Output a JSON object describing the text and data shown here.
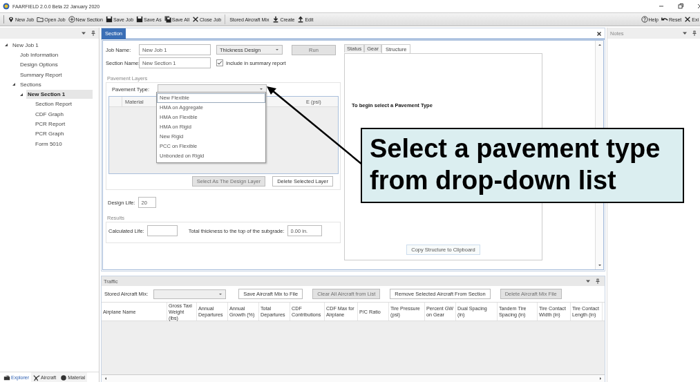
{
  "window": {
    "title": "FAARFIELD 2.0.0 Beta  22 January 2020"
  },
  "toolbar": [
    {
      "kind": "button",
      "label": "New Job"
    },
    {
      "kind": "button",
      "label": "Open Job"
    },
    {
      "kind": "button",
      "label": "New Section"
    },
    {
      "kind": "button",
      "label": "Save Job"
    },
    {
      "kind": "button",
      "label": "Save As"
    },
    {
      "kind": "button",
      "label": "Save All"
    },
    {
      "kind": "button",
      "label": "Close Job"
    },
    {
      "kind": "label",
      "label": "Stored Aircraft Mix"
    },
    {
      "kind": "button",
      "label": "Create"
    },
    {
      "kind": "button",
      "label": "Edit"
    }
  ],
  "right_toolbar": [
    "Help",
    "Reset",
    "Exi"
  ],
  "explorer": {
    "tree": [
      {
        "label": "New Job 1",
        "expanded": true,
        "selected": false,
        "children": [
          {
            "label": "Job Information",
            "selected": false
          },
          {
            "label": "Design Options",
            "selected": false
          },
          {
            "label": "Summary Report",
            "selected": false
          },
          {
            "label": "Sections",
            "expanded": true,
            "selected": false,
            "children": [
              {
                "label": "New Section 1",
                "expanded": true,
                "selected": true,
                "children": [
                  {
                    "label": "Section Report",
                    "selected": false
                  },
                  {
                    "label": "CDF Graph",
                    "selected": false
                  },
                  {
                    "label": "PCR Report",
                    "selected": false
                  },
                  {
                    "label": "PCR Graph",
                    "selected": false
                  },
                  {
                    "label": "Form 5010",
                    "selected": false
                  }
                ]
              }
            ]
          }
        ]
      }
    ],
    "bottom_tabs": [
      {
        "label": "Explorer",
        "selected": true
      },
      {
        "label": "Aircraft",
        "selected": false
      },
      {
        "label": "Material",
        "selected": false
      }
    ]
  },
  "section": {
    "tab": "Section",
    "job_name": {
      "label": "Job Name:",
      "value": "New Job 1"
    },
    "section_name": {
      "label": "Section Name:",
      "value": "New Section 1"
    },
    "design_mode": "Thickness Design",
    "run_button": {
      "label": "Run",
      "disabled": true
    },
    "include_summary": {
      "label": "Include in summary report",
      "checked": true
    },
    "pavement_layers": {
      "title": "Pavement Layers",
      "type_label": "Pavement Type:",
      "options": [
        {
          "label": "New Flexible",
          "selected": true
        },
        {
          "label": "HMA on Aggregate",
          "selected": false
        },
        {
          "label": "HMA on Flexible",
          "selected": false
        },
        {
          "label": "HMA on Rigid",
          "selected": false
        },
        {
          "label": "New Rigid",
          "selected": false
        },
        {
          "label": "PCC on Flexible",
          "selected": false
        },
        {
          "label": "Unbonded on Rigid",
          "selected": false
        }
      ],
      "columns": [
        "Material",
        "E (psi)"
      ],
      "buttons": [
        {
          "label": "Select As The Design Layer",
          "disabled": true
        },
        {
          "label": "Delete Selected Layer",
          "disabled": false
        }
      ]
    },
    "design_life": {
      "label": "Design Life:",
      "value": "20"
    },
    "results": {
      "title": "Results",
      "calculated_life": {
        "label": "Calculated Life:"
      },
      "total_thickness": {
        "label": "Total thickness to the top of the subgrade:",
        "value": "0.00 in."
      }
    },
    "tabs": [
      {
        "label": "Status",
        "selected": false
      },
      {
        "label": "Gear",
        "selected": false
      },
      {
        "label": "Structure",
        "selected": true
      }
    ],
    "structure_message": "To begin select a Pavement Type",
    "copy_button": "Copy Structure to Clipboard"
  },
  "callout": "Select a pavement type from drop-down list",
  "traffic": {
    "title": "Traffic",
    "stored_mix_label": "Stored Aircraft Mix:",
    "buttons": [
      {
        "label": "Save Aircraft Mix to File",
        "disabled": false
      },
      {
        "label": "Clear All Aircraft from List",
        "disabled": true
      },
      {
        "label": "Remove Selected Aircraft From Section",
        "disabled": false
      },
      {
        "label": "Delete Aircraft Mix File",
        "disabled": true
      }
    ],
    "columns": [
      "Airplane Name",
      "Gross Taxi Weight (lbs)",
      "Annual Departures",
      "Annual Growth (%)",
      "Total Departures",
      "CDF Contributions",
      "CDF Max for Airplane",
      "P/C Ratio",
      "Tire Pressure (psi)",
      "Percent GW on Gear",
      "Dual Spacing (in)",
      "Tandem Tire Spacing (in)",
      "Tire Contact Width (in)",
      "Tire Contact Length (in)"
    ]
  },
  "notes": {
    "title": "Notes"
  }
}
